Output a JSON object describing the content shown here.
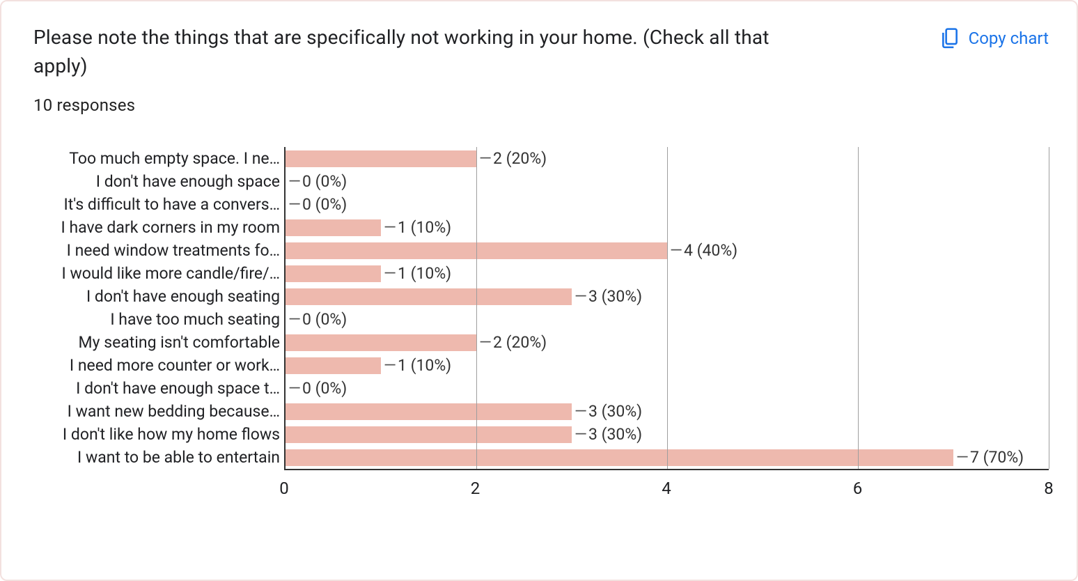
{
  "header": {
    "title": "Please note the things that are specifically not working in your home.  (Check all that apply)",
    "copy_label": "Copy chart"
  },
  "responses_label": "10 responses",
  "chart_data": {
    "type": "bar",
    "orientation": "horizontal",
    "title": "Please note the things that are specifically not working in your home.  (Check all that apply)",
    "xlabel": "",
    "ylabel": "",
    "xlim": [
      0,
      8
    ],
    "xticks": [
      0,
      2,
      4,
      6,
      8
    ],
    "total_responses": 10,
    "bar_color": "#eeb9ae",
    "series": [
      {
        "label": "Too much empty space. I ne…",
        "value": 2,
        "pct": 20,
        "data_label": "2 (20%)"
      },
      {
        "label": "I don't have enough space",
        "value": 0,
        "pct": 0,
        "data_label": "0 (0%)"
      },
      {
        "label": "It's difficult to have a convers…",
        "value": 0,
        "pct": 0,
        "data_label": "0 (0%)"
      },
      {
        "label": "I have dark corners in my room",
        "value": 1,
        "pct": 10,
        "data_label": "1 (10%)"
      },
      {
        "label": "I need window treatments fo…",
        "value": 4,
        "pct": 40,
        "data_label": "4 (40%)"
      },
      {
        "label": "I would like more candle/fire/…",
        "value": 1,
        "pct": 10,
        "data_label": "1 (10%)"
      },
      {
        "label": "I don't have enough seating",
        "value": 3,
        "pct": 30,
        "data_label": "3 (30%)"
      },
      {
        "label": "I have too much seating",
        "value": 0,
        "pct": 0,
        "data_label": "0 (0%)"
      },
      {
        "label": "My seating isn't comfortable",
        "value": 2,
        "pct": 20,
        "data_label": "2 (20%)"
      },
      {
        "label": "I need more counter or work…",
        "value": 1,
        "pct": 10,
        "data_label": "1 (10%)"
      },
      {
        "label": "I don't have enough space t…",
        "value": 0,
        "pct": 0,
        "data_label": "0 (0%)"
      },
      {
        "label": "I want new bedding because…",
        "value": 3,
        "pct": 30,
        "data_label": "3 (30%)"
      },
      {
        "label": "I don't like how my home flows",
        "value": 3,
        "pct": 30,
        "data_label": "3 (30%)"
      },
      {
        "label": "I want to be able to entertain",
        "value": 7,
        "pct": 70,
        "data_label": "7 (70%)"
      }
    ]
  }
}
